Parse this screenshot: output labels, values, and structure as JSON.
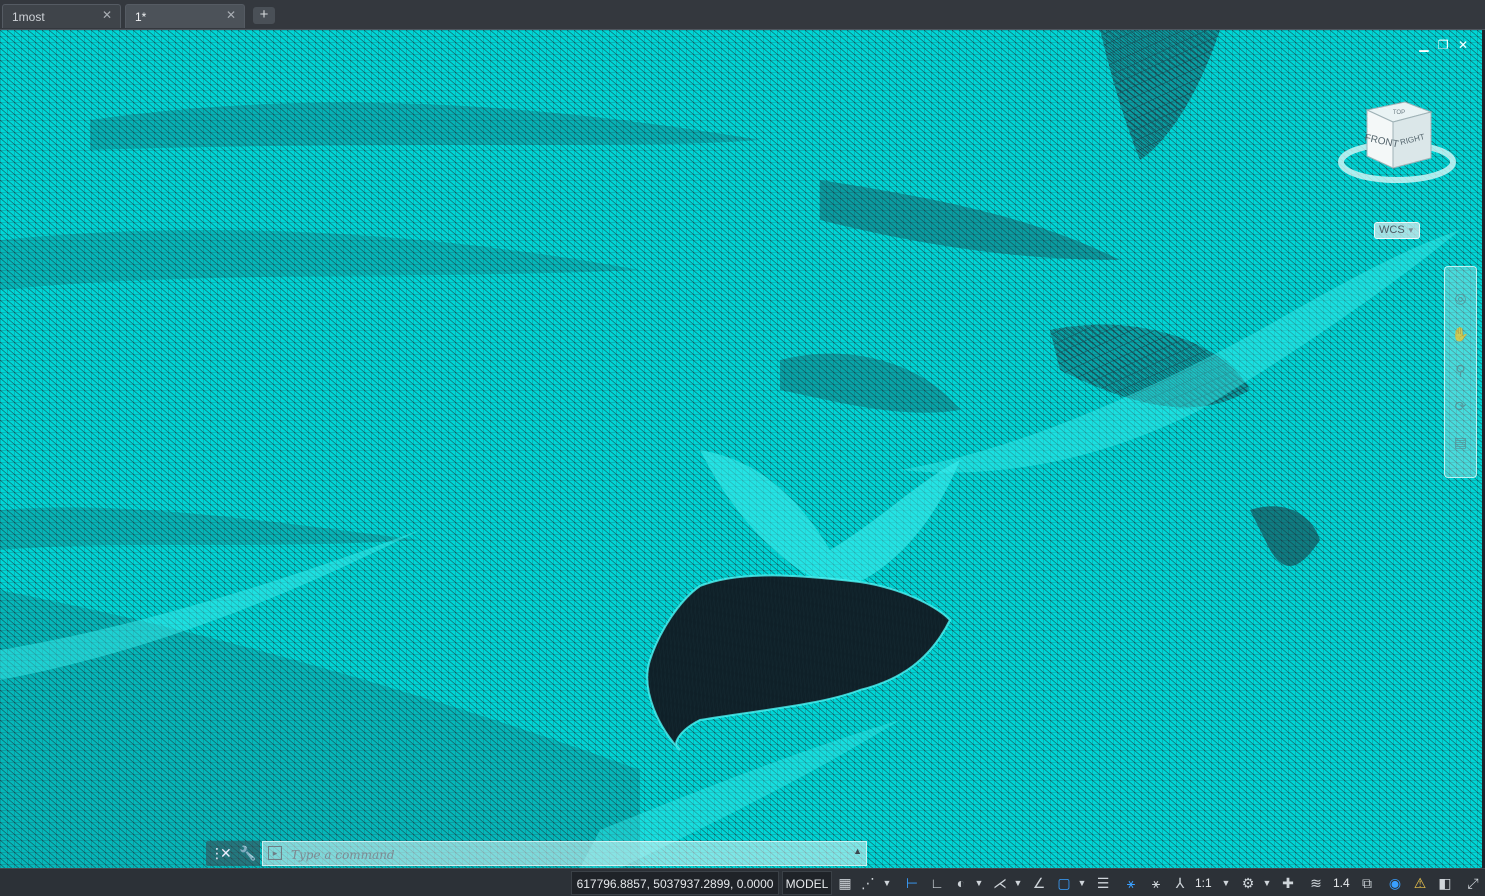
{
  "tabs": [
    {
      "label": "1most",
      "active": false
    },
    {
      "label": "1*",
      "active": true
    }
  ],
  "new_tab_icon": "+",
  "viewport": {
    "background_color": "#00d6d6",
    "mesh_color": "#1c343e",
    "controls": {
      "minimize": "▁",
      "restore": "❐",
      "close": "✕"
    },
    "viewcube": {
      "front_label": "FRONT",
      "right_label": "RIGHT",
      "top_label": "TOP"
    },
    "wcs_label": "WCS"
  },
  "command_line": {
    "placeholder": "Type a command",
    "value": ""
  },
  "status_bar": {
    "coordinates": "617796.8857, 5037937.2899, 0.0000",
    "model_label": "MODEL",
    "annotation_scale": "1:1",
    "lineweight_value": "1.4"
  }
}
